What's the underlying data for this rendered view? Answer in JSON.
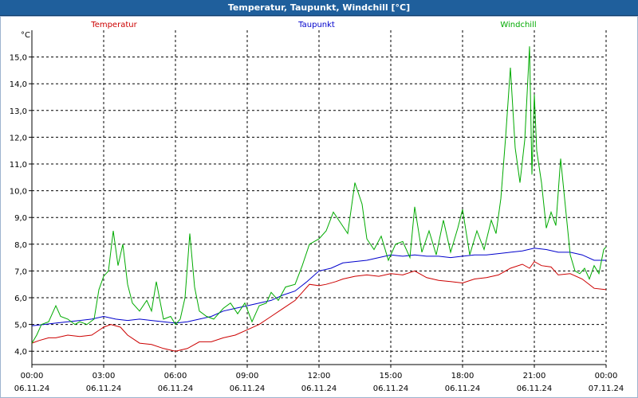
{
  "window": {
    "title": "Temperatur, Taupunkt, Windchill [°C]"
  },
  "chart_data": {
    "type": "line",
    "title": "Temperatur, Taupunkt, Windchill [°C]",
    "ylabel": "°C",
    "xlabel": "",
    "ylim": [
      3.5,
      16
    ],
    "y_ticks": [
      "4,0",
      "5,0",
      "6,0",
      "7,0",
      "8,0",
      "9,0",
      "10,0",
      "11,0",
      "12,0",
      "13,0",
      "14,0",
      "15,0"
    ],
    "y_tick_values": [
      4,
      5,
      6,
      7,
      8,
      9,
      10,
      11,
      12,
      13,
      14,
      15
    ],
    "x_hours_range": [
      0,
      24
    ],
    "x_ticks": [
      {
        "hour": 0,
        "time": "00:00",
        "date": "06.11.24"
      },
      {
        "hour": 3,
        "time": "03:00",
        "date": "06.11.24"
      },
      {
        "hour": 6,
        "time": "06:00",
        "date": "06.11.24"
      },
      {
        "hour": 9,
        "time": "09:00",
        "date": "06.11.24"
      },
      {
        "hour": 12,
        "time": "12:00",
        "date": "06.11.24"
      },
      {
        "hour": 15,
        "time": "15:00",
        "date": "06.11.24"
      },
      {
        "hour": 18,
        "time": "18:00",
        "date": "06.11.24"
      },
      {
        "hour": 21,
        "time": "21:00",
        "date": "06.11.24"
      },
      {
        "hour": 24,
        "time": "00:00",
        "date": "07.11.24"
      }
    ],
    "grid": true,
    "legend_position": "top",
    "series": [
      {
        "name": "Temperatur",
        "color": "#cc0000",
        "x": [
          0,
          0.3,
          0.7,
          1,
          1.5,
          2,
          2.5,
          3,
          3.3,
          3.7,
          4,
          4.5,
          5,
          5.5,
          6,
          6.5,
          7,
          7.5,
          8,
          8.5,
          9,
          9.5,
          10,
          10.5,
          11,
          11.3,
          11.6,
          12,
          12.3,
          12.7,
          13,
          13.5,
          14,
          14.5,
          15,
          15.5,
          16,
          16.5,
          17,
          17.5,
          18,
          18.5,
          19,
          19.5,
          20,
          20.5,
          20.8,
          21,
          21.3,
          21.7,
          22,
          22.5,
          23,
          23.5,
          24
        ],
        "values": [
          4.3,
          4.4,
          4.5,
          4.5,
          4.6,
          4.55,
          4.6,
          4.9,
          5.0,
          4.9,
          4.6,
          4.3,
          4.25,
          4.1,
          4.0,
          4.1,
          4.35,
          4.35,
          4.5,
          4.6,
          4.8,
          5.0,
          5.3,
          5.6,
          5.9,
          6.2,
          6.5,
          6.45,
          6.5,
          6.6,
          6.7,
          6.8,
          6.85,
          6.8,
          6.9,
          6.85,
          7.0,
          6.75,
          6.65,
          6.6,
          6.55,
          6.7,
          6.75,
          6.85,
          7.1,
          7.25,
          7.1,
          7.35,
          7.2,
          7.15,
          6.85,
          6.9,
          6.7,
          6.35,
          6.3
        ]
      },
      {
        "name": "Taupunkt",
        "color": "#0000cc",
        "x": [
          0,
          0.5,
          1,
          1.5,
          2,
          2.5,
          3,
          3.5,
          4,
          4.5,
          5,
          5.5,
          6,
          6.5,
          7,
          7.5,
          8,
          8.5,
          9,
          9.5,
          10,
          10.5,
          11,
          11.5,
          12,
          12.5,
          13,
          13.5,
          14,
          14.5,
          15,
          15.5,
          16,
          16.5,
          17,
          17.5,
          18,
          18.5,
          19,
          19.5,
          20,
          20.5,
          21,
          21.5,
          22,
          22.5,
          23,
          23.5,
          24
        ],
        "values": [
          4.95,
          5.0,
          5.05,
          5.1,
          5.15,
          5.2,
          5.3,
          5.2,
          5.15,
          5.2,
          5.15,
          5.1,
          5.05,
          5.1,
          5.2,
          5.3,
          5.5,
          5.6,
          5.7,
          5.8,
          5.9,
          6.1,
          6.25,
          6.6,
          7.0,
          7.1,
          7.3,
          7.35,
          7.4,
          7.5,
          7.6,
          7.55,
          7.6,
          7.55,
          7.55,
          7.5,
          7.55,
          7.6,
          7.6,
          7.65,
          7.7,
          7.75,
          7.85,
          7.8,
          7.7,
          7.7,
          7.6,
          7.4,
          7.4
        ]
      },
      {
        "name": "Windchill",
        "color": "#00aa00",
        "x": [
          0,
          0.2,
          0.4,
          0.7,
          1,
          1.2,
          1.5,
          1.8,
          2,
          2.3,
          2.6,
          2.8,
          3,
          3.2,
          3.4,
          3.6,
          3.8,
          4,
          4.2,
          4.5,
          4.8,
          5,
          5.2,
          5.5,
          5.8,
          6,
          6.2,
          6.4,
          6.6,
          6.8,
          7,
          7.3,
          7.6,
          8,
          8.3,
          8.6,
          8.9,
          9.2,
          9.5,
          9.8,
          10,
          10.3,
          10.6,
          11,
          11.3,
          11.6,
          12,
          12.3,
          12.6,
          12.9,
          13.2,
          13.5,
          13.8,
          14,
          14.3,
          14.6,
          14.9,
          15.2,
          15.5,
          15.8,
          16,
          16.3,
          16.6,
          16.9,
          17.2,
          17.5,
          17.8,
          18,
          18.3,
          18.6,
          18.9,
          19.2,
          19.4,
          19.6,
          19.8,
          20,
          20.2,
          20.4,
          20.6,
          20.8,
          20.9,
          21,
          21.1,
          21.3,
          21.5,
          21.7,
          21.9,
          22.1,
          22.3,
          22.5,
          22.7,
          22.9,
          23.1,
          23.3,
          23.5,
          23.7,
          23.9,
          24
        ],
        "values": [
          4.3,
          4.6,
          5.0,
          5.1,
          5.7,
          5.3,
          5.2,
          5.0,
          5.1,
          5.0,
          5.2,
          6.3,
          6.8,
          7.0,
          8.5,
          7.2,
          8.0,
          6.5,
          5.8,
          5.5,
          5.9,
          5.5,
          6.6,
          5.2,
          5.3,
          5.0,
          5.2,
          6.0,
          8.4,
          6.4,
          5.5,
          5.3,
          5.2,
          5.6,
          5.8,
          5.4,
          5.8,
          5.1,
          5.7,
          5.8,
          6.2,
          5.9,
          6.4,
          6.5,
          7.2,
          8.0,
          8.2,
          8.5,
          9.2,
          8.8,
          8.4,
          10.3,
          9.5,
          8.2,
          7.8,
          8.3,
          7.4,
          8.0,
          8.1,
          7.5,
          9.4,
          7.7,
          8.5,
          7.6,
          8.9,
          7.7,
          8.6,
          9.3,
          7.6,
          8.5,
          7.8,
          8.9,
          8.4,
          9.7,
          12.0,
          14.6,
          11.6,
          10.3,
          11.9,
          15.4,
          10.6,
          13.6,
          11.5,
          10.3,
          8.6,
          9.2,
          8.7,
          11.2,
          9.4,
          7.6,
          7.0,
          6.9,
          7.1,
          6.7,
          7.2,
          6.9,
          7.8,
          7.9
        ]
      }
    ]
  }
}
